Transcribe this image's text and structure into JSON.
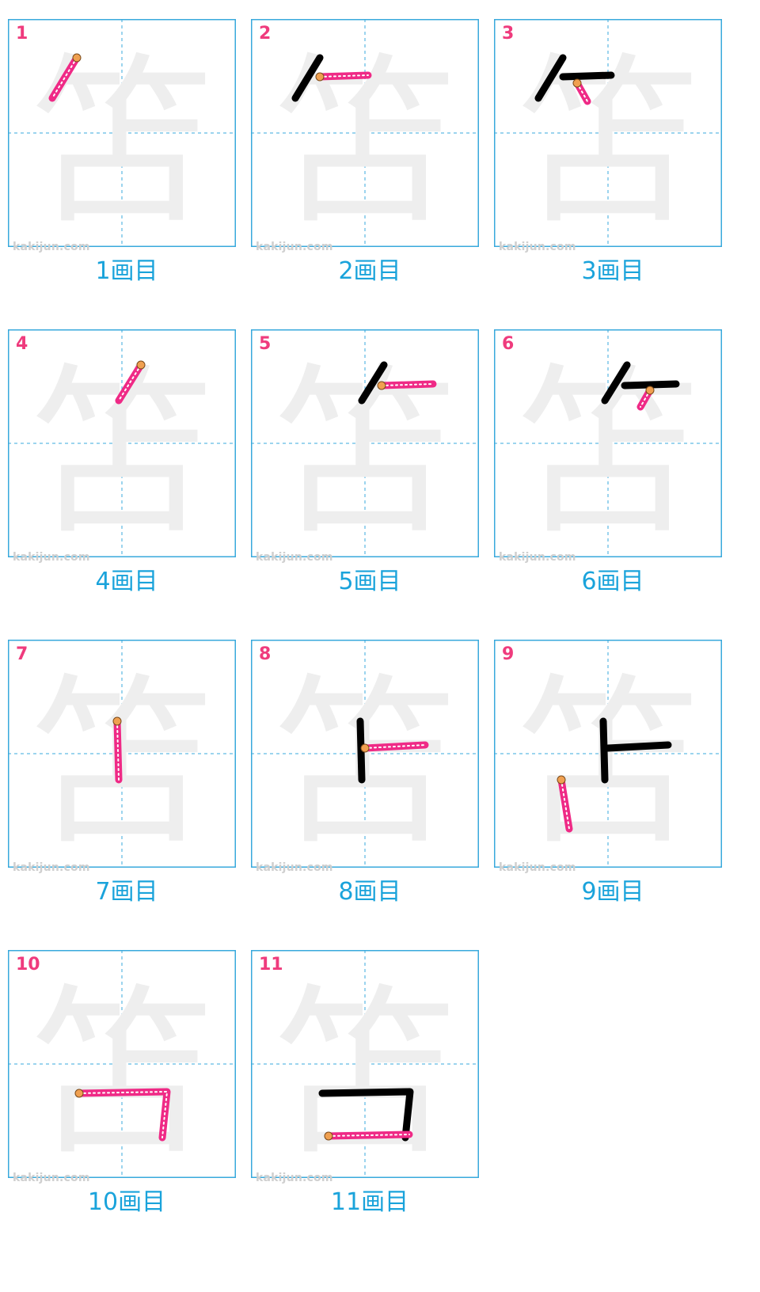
{
  "kanji": "笘",
  "watermark": "kakijun.com",
  "panels": [
    {
      "number": "1",
      "caption": "1画目"
    },
    {
      "number": "2",
      "caption": "2画目"
    },
    {
      "number": "3",
      "caption": "3画目"
    },
    {
      "number": "4",
      "caption": "4画目"
    },
    {
      "number": "5",
      "caption": "5画目"
    },
    {
      "number": "6",
      "caption": "6画目"
    },
    {
      "number": "7",
      "caption": "7画目"
    },
    {
      "number": "8",
      "caption": "8画目"
    },
    {
      "number": "9",
      "caption": "9画目"
    },
    {
      "number": "10",
      "caption": "10画目"
    },
    {
      "number": "11",
      "caption": "11画目"
    }
  ],
  "colors": {
    "frame": "#39a9dc",
    "guide": "#39a9dc",
    "ghost": "#eeeeee",
    "done": "#000000",
    "current": "#ef2a86",
    "start_dot": "#f0a050",
    "number": "#ef3b7d",
    "caption": "#1aa3db",
    "watermark": "#cfcfcf"
  }
}
